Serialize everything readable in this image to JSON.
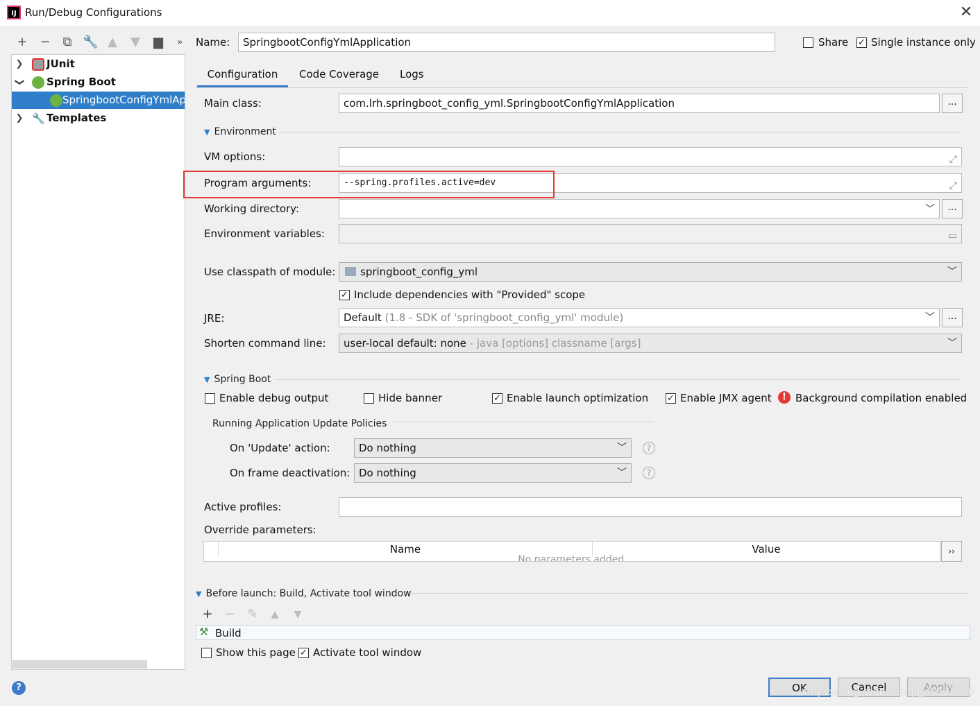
{
  "window": {
    "title": "Run/Debug Configurations",
    "logo": "IJ"
  },
  "toolbar": {
    "icons": [
      "plus-icon",
      "minus-icon",
      "copy-icon",
      "wrench-icon",
      "arrow-up-icon",
      "arrow-down-icon",
      "folder-add-icon",
      "more-icon"
    ]
  },
  "tree": {
    "items": [
      {
        "label": "JUnit"
      },
      {
        "label": "Spring Boot"
      },
      {
        "label": "SpringbootConfigYmlAp"
      },
      {
        "label": "Templates"
      }
    ]
  },
  "header": {
    "name_label": "Name:",
    "name_value": "SpringbootConfigYmlApplication",
    "share_label": "Share",
    "single_instance_label": "Single instance only"
  },
  "tabs": [
    {
      "label": "Configuration"
    },
    {
      "label": "Code Coverage"
    },
    {
      "label": "Logs"
    }
  ],
  "config": {
    "main_class_label": "Main class:",
    "main_class_value": "com.lrh.springboot_config_yml.SpringbootConfigYmlApplication",
    "environment_section": "Environment",
    "vm_options_label": "VM options:",
    "vm_options_value": "",
    "program_args_label": "Program arguments:",
    "program_args_value": "--spring.profiles.active=dev",
    "working_dir_label": "Working directory:",
    "working_dir_value": "",
    "env_vars_label": "Environment variables:",
    "env_vars_value": "",
    "classpath_label": "Use classpath of module:",
    "classpath_value": "springboot_config_yml",
    "include_deps_label": "Include dependencies with \"Provided\" scope",
    "jre_label": "JRE:",
    "jre_value": "Default",
    "jre_hint": "(1.8 - SDK of 'springboot_config_yml' module)",
    "shorten_label": "Shorten command line:",
    "shorten_value": "user-local default: none",
    "shorten_hint": "- java [options] classname [args]"
  },
  "spring_boot": {
    "section": "Spring Boot",
    "debug_output": "Enable debug output",
    "hide_banner": "Hide banner",
    "launch_opt": "Enable launch optimization",
    "jmx_agent": "Enable JMX agent",
    "bg_compilation": "Background compilation enabled",
    "policies_section": "Running Application Update Policies",
    "update_action_label": "On 'Update' action:",
    "update_action_value": "Do nothing",
    "frame_deact_label": "On frame deactivation:",
    "frame_deact_value": "Do nothing",
    "active_profiles_label": "Active profiles:",
    "active_profiles_value": "",
    "override_label": "Override parameters:",
    "table_headers": [
      "Name",
      "Value"
    ],
    "table_empty": "No parameters added."
  },
  "before_launch": {
    "section": "Before launch: Build, Activate tool window",
    "build_item": "Build",
    "show_page": "Show this page",
    "activate_tool": "Activate tool window"
  },
  "buttons": {
    "ok": "OK",
    "cancel": "Cancel",
    "apply": "Apply"
  },
  "watermark": "https://blog.csdn.net/qq_40533000",
  "colors": {
    "accent": "#3d7cc9",
    "selection": "#2f7ec9",
    "highlight_box": "#e53935",
    "spring_green": "#6db33f"
  }
}
